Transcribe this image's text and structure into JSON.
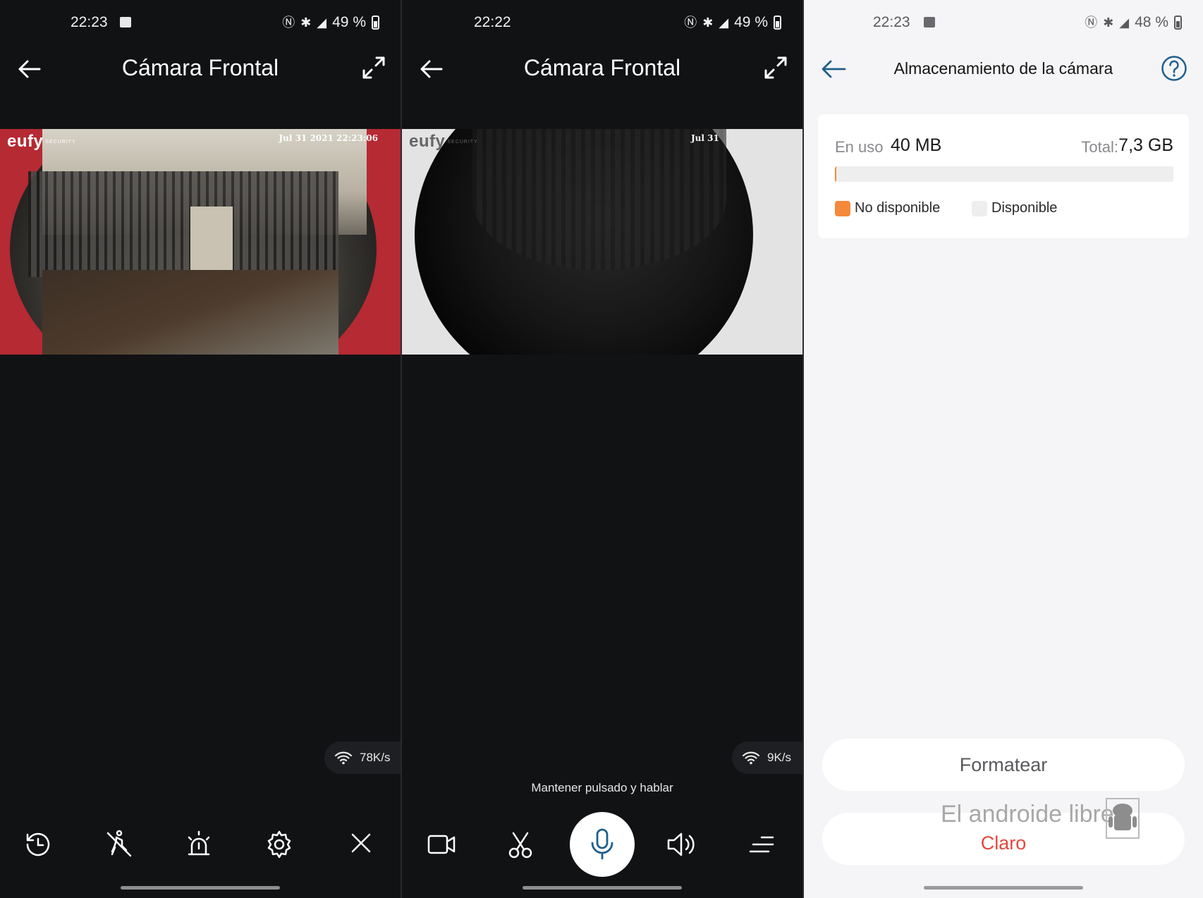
{
  "screens": [
    {
      "status": {
        "time": "22:23",
        "battery": "49 %"
      },
      "header": {
        "title": "Cámara Frontal"
      },
      "feed": {
        "brand": "eufy",
        "brand_sub": "SECURITY",
        "timestamp": "Jul 31 2021  22:23:06"
      },
      "speed": "78K/s",
      "toolbar": [
        "history-icon",
        "motion-off-icon",
        "alarm-icon",
        "settings-icon",
        "close-icon"
      ]
    },
    {
      "status": {
        "time": "22:22",
        "battery": "49 %"
      },
      "header": {
        "title": "Cámara Frontal"
      },
      "feed": {
        "brand": "eufy",
        "brand_sub": "SECURITY",
        "timestamp": "Jul 31"
      },
      "speed": "9K/s",
      "hint": "Mantener pulsado y hablar",
      "toolbar": [
        "record-icon",
        "snapshot-icon",
        "microphone-icon",
        "speaker-icon",
        "menu-icon"
      ]
    },
    {
      "status": {
        "time": "22:23",
        "battery": "48 %"
      },
      "header": {
        "title": "Almacenamiento de la cámara"
      },
      "storage": {
        "used_label": "En uso",
        "used_value": "40 MB",
        "total_label": "Total:",
        "total_value": "7,3 GB",
        "used_fraction": 0.005,
        "legend_unavailable": "No disponible",
        "legend_available": "Disponible",
        "color_used": "#f5893a",
        "color_free": "#eeeeef"
      },
      "buttons": {
        "format": "Formatear",
        "clear": "Claro"
      },
      "watermark": "El androide libre"
    }
  ]
}
